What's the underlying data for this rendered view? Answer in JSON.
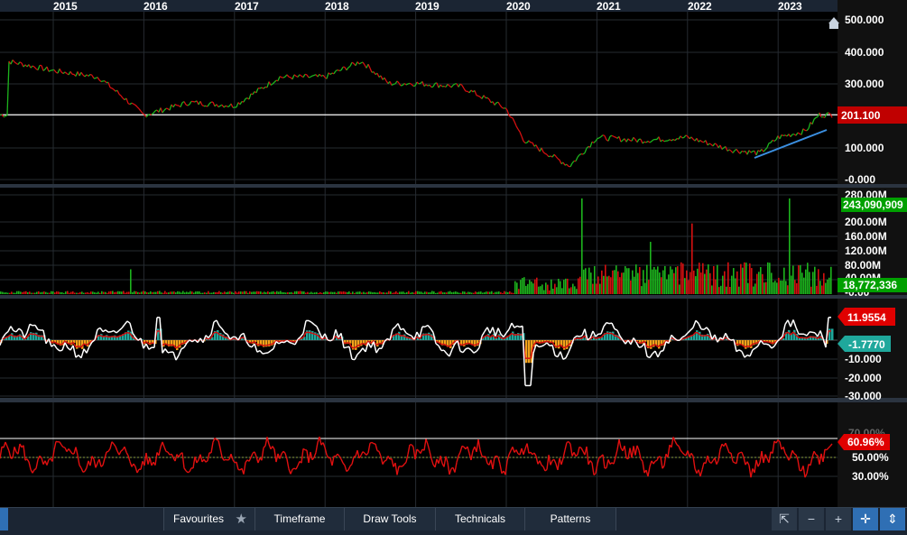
{
  "x_axis": {
    "years": [
      "2015",
      "2016",
      "2017",
      "2018",
      "2019",
      "2020",
      "2021",
      "2022",
      "2023"
    ]
  },
  "panels": {
    "price": {
      "ticks": [
        "500.000",
        "400.000",
        "300.000",
        "200.000",
        "100.000",
        "-0.000"
      ],
      "last_price": "201.100",
      "last_price_color": "#c00000"
    },
    "volume": {
      "ticks": [
        "280.00M",
        "200.00M",
        "160.00M",
        "120.00M",
        "80.00M",
        "40.00M",
        "-0.00"
      ],
      "last_volume": "243,090,909",
      "avg_volume": "18,772,336",
      "label_color": "#00a000"
    },
    "oscillator": {
      "ticks": [
        "-10.000",
        "-20.000",
        "-30.000"
      ],
      "value": "11.9554",
      "signal": "-1.7770",
      "value_color": "#e00000",
      "signal_color": "#1fa89c"
    },
    "percent": {
      "ticks": [
        "70.00%",
        "50.00%",
        "30.00%"
      ],
      "value": "60.96%",
      "value_color": "#e00000"
    }
  },
  "toolbar": {
    "favourites": "Favourites",
    "timeframe": "Timeframe",
    "draw_tools": "Draw Tools",
    "technicals": "Technicals",
    "patterns": "Patterns",
    "minus": "−",
    "plus": "+"
  },
  "chart_data": [
    {
      "type": "line",
      "x": [
        2014.5,
        2015.0,
        2015.5,
        2015.8,
        2016.0,
        2016.5,
        2017.0,
        2017.5,
        2018.0,
        2018.4,
        2018.7,
        2019.0,
        2019.5,
        2020.0,
        2020.2,
        2020.7,
        2021.0,
        2021.5,
        2022.0,
        2022.5,
        2022.8,
        2023.0,
        2023.3,
        2023.45
      ],
      "y": [
        370,
        340,
        320,
        250,
        200,
        240,
        230,
        320,
        320,
        370,
        300,
        300,
        290,
        220,
        120,
        40,
        130,
        120,
        130,
        90,
        80,
        130,
        150,
        201.1
      ],
      "ylim": [
        0,
        500
      ]
    },
    {
      "type": "bar",
      "ylim": [
        0,
        280000000
      ],
      "note_values": [
        "243,090,909",
        "18,772,336"
      ]
    },
    {
      "type": "line",
      "ylim": [
        -30,
        20
      ]
    },
    {
      "type": "line",
      "ylim": [
        20,
        80
      ]
    }
  ]
}
